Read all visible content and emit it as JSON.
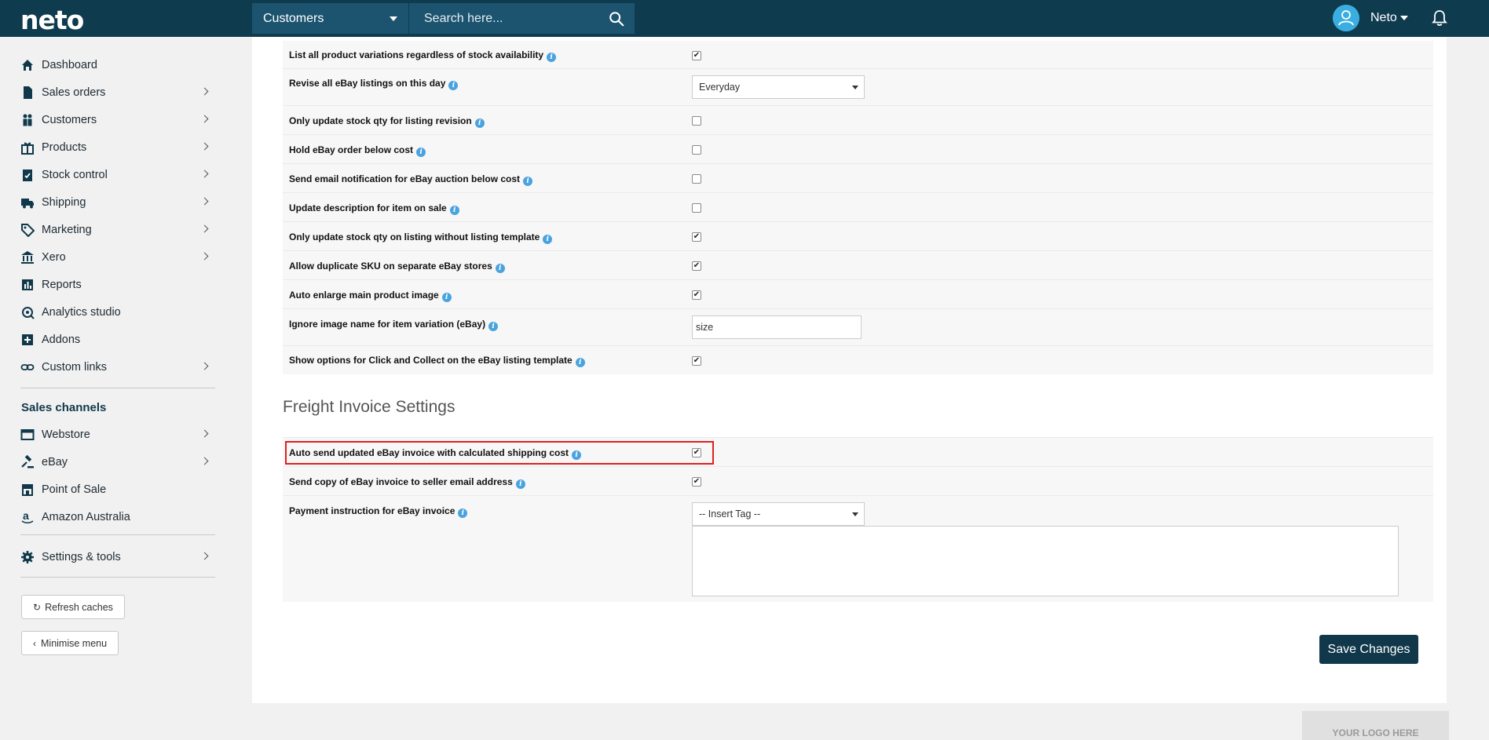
{
  "header": {
    "logo": "neto",
    "section": "Customers",
    "search_placeholder": "Search here...",
    "user": "Neto"
  },
  "sidebar": {
    "items": [
      {
        "label": "Dashboard",
        "icon": "home-icon"
      },
      {
        "label": "Sales orders",
        "icon": "document-icon"
      },
      {
        "label": "Customers",
        "icon": "people-icon"
      },
      {
        "label": "Products",
        "icon": "gift-icon"
      },
      {
        "label": "Stock control",
        "icon": "clipboard-check-icon"
      },
      {
        "label": "Shipping",
        "icon": "truck-icon"
      },
      {
        "label": "Marketing",
        "icon": "tag-icon"
      },
      {
        "label": "Xero",
        "icon": "bank-icon"
      },
      {
        "label": "Reports",
        "icon": "bar-chart-icon"
      },
      {
        "label": "Analytics studio",
        "icon": "analytics-icon"
      },
      {
        "label": "Addons",
        "icon": "plus-square-icon"
      },
      {
        "label": "Custom links",
        "icon": "link-icon"
      }
    ],
    "channels_heading": "Sales channels",
    "channels": [
      {
        "label": "Webstore",
        "icon": "browser-icon"
      },
      {
        "label": "eBay",
        "icon": "gavel-icon"
      },
      {
        "label": "Point of Sale",
        "icon": "store-icon"
      },
      {
        "label": "Amazon Australia",
        "icon": "amazon-icon"
      }
    ],
    "settings_label": "Settings & tools",
    "refresh_label": "Refresh caches",
    "minimise_label": "Minimise menu"
  },
  "settings": {
    "rows": [
      {
        "label": "List all product variations regardless of stock availability",
        "control": "checkbox",
        "checked": true
      },
      {
        "label": "Revise all eBay listings on this day",
        "control": "select",
        "value": "Everyday"
      },
      {
        "label": "Only update stock qty for listing revision",
        "control": "checkbox",
        "checked": false
      },
      {
        "label": "Hold eBay order below cost",
        "control": "checkbox",
        "checked": false
      },
      {
        "label": "Send email notification for eBay auction below cost",
        "control": "checkbox",
        "checked": false
      },
      {
        "label": "Update description for item on sale",
        "control": "checkbox",
        "checked": false
      },
      {
        "label": "Only update stock qty on listing without listing template",
        "control": "checkbox",
        "checked": true
      },
      {
        "label": "Allow duplicate SKU on separate eBay stores",
        "control": "checkbox",
        "checked": true
      },
      {
        "label": "Auto enlarge main product image",
        "control": "checkbox",
        "checked": true
      },
      {
        "label": "Ignore image name for item variation (eBay)",
        "control": "text",
        "value": "size"
      },
      {
        "label": "Show options for Click and Collect on the eBay listing template",
        "control": "checkbox",
        "checked": true
      }
    ]
  },
  "freight": {
    "title": "Freight Invoice Settings",
    "rows": [
      {
        "label": "Auto send updated eBay invoice with calculated shipping cost",
        "control": "checkbox",
        "checked": true
      },
      {
        "label": "Send copy of eBay invoice to seller email address",
        "control": "checkbox",
        "checked": true
      },
      {
        "label": "Payment instruction for eBay invoice",
        "control": "select",
        "value": "-- Insert Tag --"
      }
    ]
  },
  "actions": {
    "save_label": "Save Changes"
  },
  "footer": {
    "logo_placeholder": "YOUR LOGO HERE"
  },
  "colors": {
    "topbar": "#0f3b4f",
    "search": "#1c5470",
    "accent": "#3aaee0",
    "highlight": "#e02020"
  }
}
